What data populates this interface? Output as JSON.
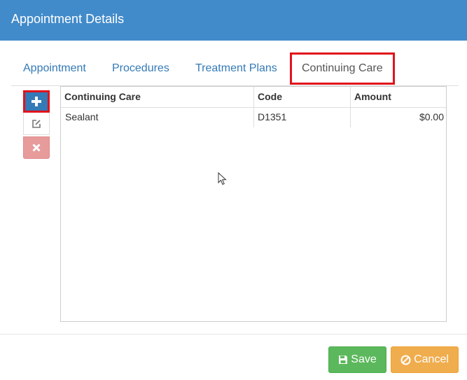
{
  "window": {
    "title": "Appointment Details"
  },
  "tabs": [
    {
      "label": "Appointment",
      "active": false
    },
    {
      "label": "Procedures",
      "active": false
    },
    {
      "label": "Treatment Plans",
      "active": false
    },
    {
      "label": "Continuing Care",
      "active": true
    }
  ],
  "actions": {
    "add_icon": "plus-icon",
    "edit_icon": "edit-icon",
    "delete_icon": "times-icon"
  },
  "table": {
    "columns": [
      "Continuing Care",
      "Code",
      "Amount"
    ],
    "rows": [
      {
        "continuing_care": "Sealant",
        "code": "D1351",
        "amount": "$0.00"
      }
    ]
  },
  "footer": {
    "save_label": "Save",
    "save_icon": "floppy-disk-icon",
    "cancel_label": "Cancel",
    "cancel_icon": "ban-icon"
  },
  "colors": {
    "header": "#428bca",
    "primary": "#337ab7",
    "highlight": "#e0141c",
    "save": "#5cb85c",
    "cancel": "#f0ad4e",
    "delete": "#e79b9b"
  }
}
